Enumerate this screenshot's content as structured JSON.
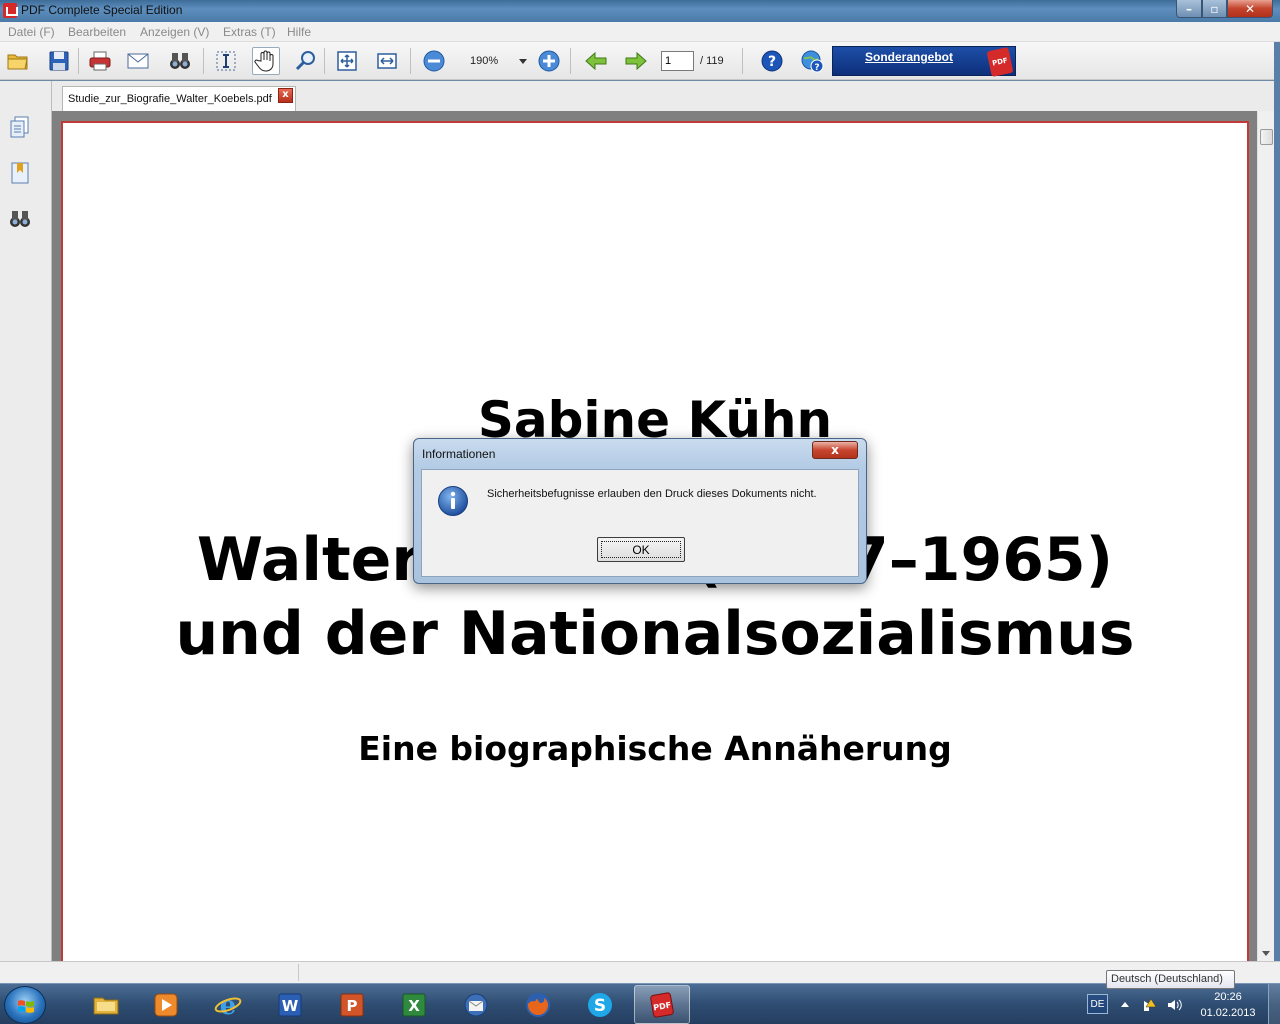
{
  "window": {
    "title": "PDF Complete Special Edition",
    "min_symbol": "–",
    "max_symbol": "▫",
    "close_symbol": "✕"
  },
  "menu": [
    "Datei (F)",
    "Bearbeiten",
    "Anzeigen (V)",
    "Extras (T)",
    "Hilfe"
  ],
  "toolbar": {
    "zoom": "190%",
    "page_current": "1",
    "page_total": "/ 119",
    "promo_label": "Sonderangebot",
    "promo_badge": "PDF"
  },
  "tab": {
    "filename": "Studie_zur_Biografie_Walter_Koebels.pdf",
    "close_symbol": "x"
  },
  "document": {
    "author": "Sabine Kühn",
    "title_line1": "Walter Koebel (1907–1965)",
    "title_line2": "und der Nationalsozialismus",
    "subtitle": "Eine biographische Annäherung"
  },
  "dialog": {
    "title": "Informationen",
    "close_symbol": "x",
    "message": "Sicherheitsbefugnisse erlauben den Druck dieses Dokuments nicht.",
    "ok_label": "OK"
  },
  "taskbar": {
    "language": "DE",
    "time": "20:26",
    "date": "01.02.2013",
    "tooltip": "Deutsch (Deutschland)"
  },
  "colors": {
    "page_border": "#c03a3a",
    "promo_blue": "#1d4fa8",
    "pdf_red": "#d42a2a",
    "info_blue": "#2158a8"
  }
}
